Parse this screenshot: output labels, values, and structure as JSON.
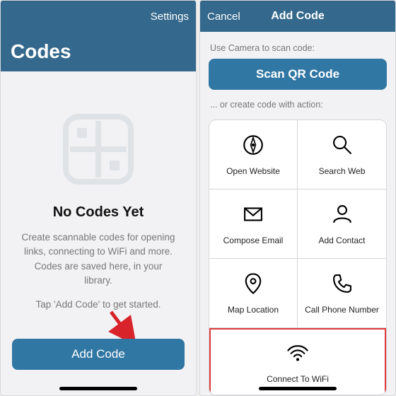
{
  "left": {
    "nav": {
      "settings": "Settings"
    },
    "title": "Codes",
    "empty": {
      "heading": "No Codes Yet",
      "line1": "Create scannable codes for opening links, connecting to WiFi and more. Codes are saved here, in your library.",
      "line2": "Tap 'Add Code' to get started."
    },
    "addButton": "Add Code"
  },
  "right": {
    "nav": {
      "cancel": "Cancel",
      "title": "Add Code"
    },
    "hint1": "Use Camera to scan code:",
    "scanButton": "Scan QR Code",
    "hint2": "... or create code with action:",
    "actions": {
      "openWebsite": "Open Website",
      "searchWeb": "Search Web",
      "composeEmail": "Compose Email",
      "addContact": "Add Contact",
      "mapLocation": "Map Location",
      "callPhone": "Call Phone Number",
      "connectWifi": "Connect To WiFi"
    }
  },
  "colors": {
    "accent": "#3177a4",
    "highlight": "#de3a3a"
  }
}
